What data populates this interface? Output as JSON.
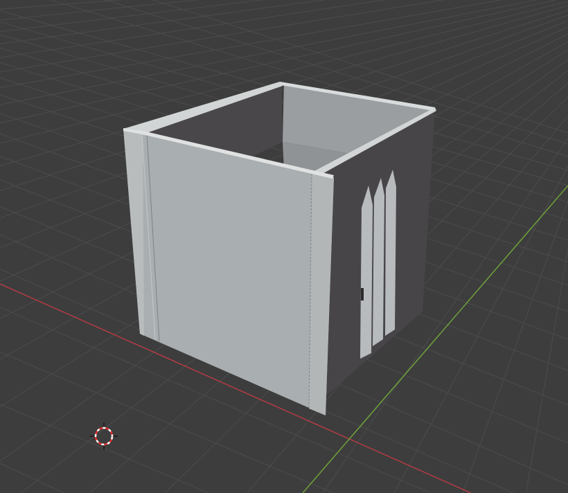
{
  "viewport": {
    "background": "#3d3d3d",
    "grid_color": "#4c4c4c",
    "x_axis_color": "#b43c44",
    "y_axis_color": "#6ea33a"
  },
  "scene": {
    "object": "room-box",
    "wall_light_color": "#a9aeb0",
    "wall_inner_color": "#4a474a",
    "window_color": "#b7bbbd",
    "wall_top_edge_color": "#d9dcdc"
  },
  "cursor_3d": {
    "icon": "3d-cursor-icon",
    "ring_colors": [
      "#e03030",
      "#ffffff"
    ]
  }
}
